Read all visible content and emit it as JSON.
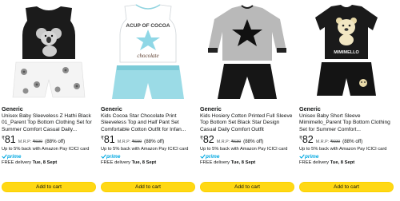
{
  "products": [
    {
      "brand": "Generic",
      "title": "Unisex Baby Sleeveless Z Hathi Black 01_Parent Top Bottom Clothing Set for Summer Comfort Casual Daily...",
      "currency": "₹",
      "price": "81",
      "mrp_label": "M.R.P:",
      "mrp": "₹699",
      "discount": "(88% off)",
      "cashback": "Up to 5% back with Amazon Pay ICICI card",
      "prime": "prime",
      "delivery_prefix": "FREE delivery ",
      "delivery_date": "Tue, 8 Sept",
      "cart_label": "Add to cart",
      "image": "koala-black-vest-set"
    },
    {
      "brand": "Generic",
      "title": "Kids Cocoa Star Chocolate Print Sleeveless Top and Half Pant Set Comfortable Cotton Outfit for Infan...",
      "currency": "₹",
      "price": "81",
      "mrp_label": "M.R.P:",
      "mrp": "₹699",
      "discount": "(88% off)",
      "cashback": "Up to 5% back with Amazon Pay ICICI card",
      "prime": "prime",
      "delivery_prefix": "FREE delivery ",
      "delivery_date": "Tue, 8 Sept",
      "cart_label": "Add to cart",
      "image": "cocoa-star-white-vest-set",
      "print_top": "ACUP OF COCOA",
      "print_bottom": "chocolate"
    },
    {
      "brand": "Generic",
      "title": "Kids Hosiery Cotton Printed Full Sleeve Top Bottom Set Black Star Design Casual Daily Comfort Outfit",
      "currency": "₹",
      "price": "82",
      "mrp_label": "M.R.P:",
      "mrp": "₹630",
      "discount": "(88% off)",
      "cashback": "Up to 5% back with Amazon Pay ICICI card",
      "prime": "prime",
      "delivery_prefix": "FREE delivery ",
      "delivery_date": "Tue, 8 Sept",
      "cart_label": "Add to cart",
      "image": "grey-star-full-sleeve-set"
    },
    {
      "brand": "Generic",
      "title": "Unisex Baby Short Sleeve Mimimello_Parent Top Bottom Clothing Set for Summer Comfort...",
      "currency": "₹",
      "price": "82",
      "mrp_label": "M.R.P:",
      "mrp": "₹699",
      "discount": "(88% off)",
      "cashback": "Up to 5% back with Amazon Pay ICICI card",
      "prime": "prime",
      "delivery_prefix": "FREE delivery ",
      "delivery_date": "Tue, 8 Sept",
      "cart_label": "Add to cart",
      "image": "mimimello-bear-black-set",
      "print_text": "MIMIMELLO"
    }
  ],
  "colors": {
    "cart_button": "#ffd814",
    "prime": "#00a8e1",
    "text": "#0f1111",
    "muted": "#565959"
  }
}
